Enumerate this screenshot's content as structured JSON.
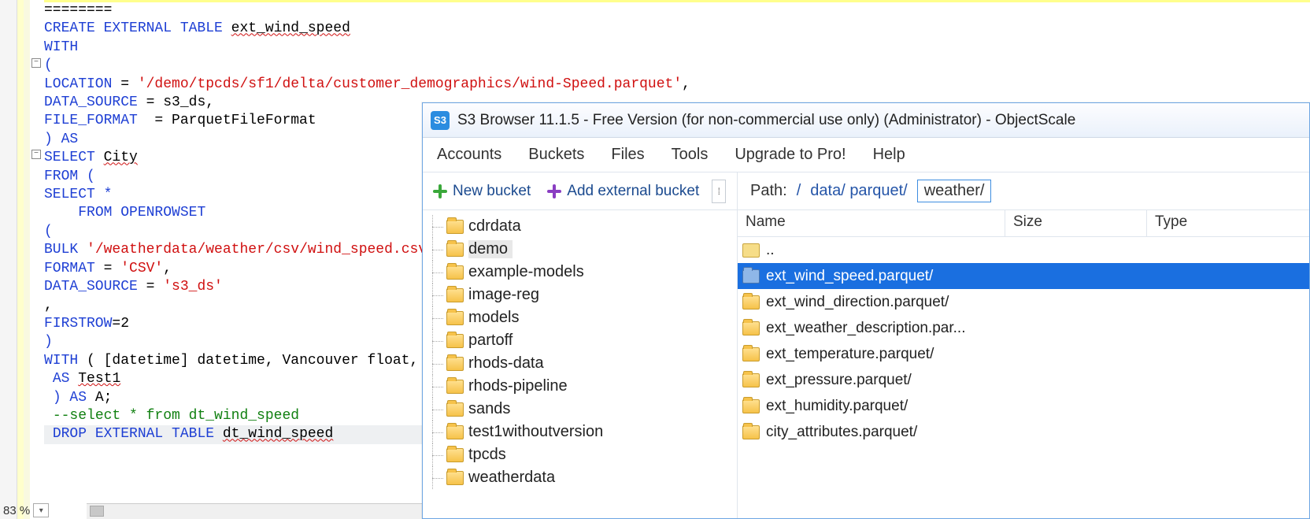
{
  "editor": {
    "zoom": "83 %",
    "lines": [
      {
        "t": [
          {
            "c": "",
            "s": "========"
          }
        ]
      },
      {
        "t": [
          {
            "c": "k",
            "s": "CREATE EXTERNAL TABLE"
          },
          {
            "c": "",
            "s": " "
          },
          {
            "c": "squig",
            "s": "ext_wind_speed"
          }
        ]
      },
      {
        "t": [
          {
            "c": "k",
            "s": "WITH"
          }
        ]
      },
      {
        "t": [
          {
            "c": "k",
            "s": "("
          }
        ]
      },
      {
        "t": [
          {
            "c": "k",
            "s": "LOCATION"
          },
          {
            "c": "",
            "s": " = "
          },
          {
            "c": "str",
            "s": "'/demo/tpcds/sf1/delta/customer_demographics/wind-Speed.parquet'"
          },
          {
            "c": "",
            "s": ","
          }
        ]
      },
      {
        "t": [
          {
            "c": "k",
            "s": "DATA_SOURCE"
          },
          {
            "c": "",
            "s": " = s3_ds,"
          }
        ]
      },
      {
        "t": [
          {
            "c": "k",
            "s": "FILE_FORMAT"
          },
          {
            "c": "",
            "s": "  = ParquetFileFormat"
          }
        ]
      },
      {
        "t": [
          {
            "c": "k",
            "s": ") AS"
          }
        ]
      },
      {
        "t": [
          {
            "c": "k",
            "s": "SELECT"
          },
          {
            "c": "",
            "s": " "
          },
          {
            "c": "squig",
            "s": "City"
          }
        ]
      },
      {
        "t": [
          {
            "c": "k",
            "s": "FROM ("
          }
        ]
      },
      {
        "t": [
          {
            "c": "k",
            "s": "SELECT *"
          }
        ]
      },
      {
        "t": [
          {
            "c": "",
            "s": "    "
          },
          {
            "c": "k",
            "s": "FROM OPENROWSET"
          }
        ]
      },
      {
        "t": [
          {
            "c": "k",
            "s": "("
          }
        ]
      },
      {
        "t": [
          {
            "c": "k",
            "s": "BULK"
          },
          {
            "c": "",
            "s": " "
          },
          {
            "c": "str",
            "s": "'/weatherdata/weather/csv/wind_speed.csv'"
          },
          {
            "c": "",
            "s": ","
          }
        ]
      },
      {
        "t": [
          {
            "c": "k",
            "s": "FORMAT"
          },
          {
            "c": "",
            "s": " = "
          },
          {
            "c": "str",
            "s": "'CSV'"
          },
          {
            "c": "",
            "s": ","
          }
        ]
      },
      {
        "t": [
          {
            "c": "k",
            "s": "DATA_SOURCE"
          },
          {
            "c": "",
            "s": " = "
          },
          {
            "c": "str",
            "s": "'s3_ds'"
          }
        ]
      },
      {
        "t": [
          {
            "c": "",
            "s": ","
          }
        ]
      },
      {
        "t": [
          {
            "c": "k",
            "s": "FIRSTROW"
          },
          {
            "c": "",
            "s": "=2"
          }
        ]
      },
      {
        "t": [
          {
            "c": "k",
            "s": ")"
          }
        ]
      },
      {
        "t": [
          {
            "c": "k",
            "s": "WITH"
          },
          {
            "c": "",
            "s": " ( [datetime] datetime, Vancouver float, Port"
          }
        ]
      },
      {
        "t": [
          {
            "c": "",
            "s": " "
          },
          {
            "c": "k",
            "s": "AS"
          },
          {
            "c": "",
            "s": " "
          },
          {
            "c": "squig",
            "s": "Test1"
          }
        ]
      },
      {
        "t": [
          {
            "c": "",
            "s": " "
          },
          {
            "c": "k",
            "s": ") AS"
          },
          {
            "c": "",
            "s": " A;"
          }
        ]
      },
      {
        "t": [
          {
            "c": "",
            "s": ""
          }
        ]
      },
      {
        "t": [
          {
            "c": "",
            "s": " "
          },
          {
            "c": "cmt",
            "s": "--select * from dt_wind_speed"
          }
        ]
      },
      {
        "t": [
          {
            "c": "",
            "s": " "
          },
          {
            "c": "k",
            "s": "DROP EXTERNAL TABLE"
          },
          {
            "c": "",
            "s": " "
          },
          {
            "c": "squig",
            "s": "dt_wind_speed"
          }
        ],
        "hl": true
      }
    ]
  },
  "s3": {
    "title": "S3 Browser 11.1.5 - Free Version (for non-commercial use only) (Administrator) - ObjectScale",
    "menu": [
      "Accounts",
      "Buckets",
      "Files",
      "Tools",
      "Upgrade to Pro!",
      "Help"
    ],
    "toolbar": {
      "new_bucket": "New bucket",
      "add_external": "Add external bucket"
    },
    "path": {
      "label": "Path:",
      "root": "/",
      "segs": [
        "data/",
        "parquet/"
      ],
      "current": "weather/"
    },
    "tree": [
      "cdrdata",
      "demo",
      "example-models",
      "image-reg",
      "models",
      "partoff",
      "rhods-data",
      "rhods-pipeline",
      "sands",
      "test1withoutversion",
      "tpcds",
      "weatherdata"
    ],
    "tree_selected": "demo",
    "columns": {
      "name": "Name",
      "size": "Size",
      "type": "Type"
    },
    "rows": [
      {
        "name": "..",
        "up": true
      },
      {
        "name": "ext_wind_speed.parquet/",
        "selected": true
      },
      {
        "name": "ext_wind_direction.parquet/"
      },
      {
        "name": "ext_weather_description.par..."
      },
      {
        "name": "ext_temperature.parquet/"
      },
      {
        "name": "ext_pressure.parquet/"
      },
      {
        "name": "ext_humidity.parquet/"
      },
      {
        "name": "city_attributes.parquet/"
      }
    ]
  }
}
